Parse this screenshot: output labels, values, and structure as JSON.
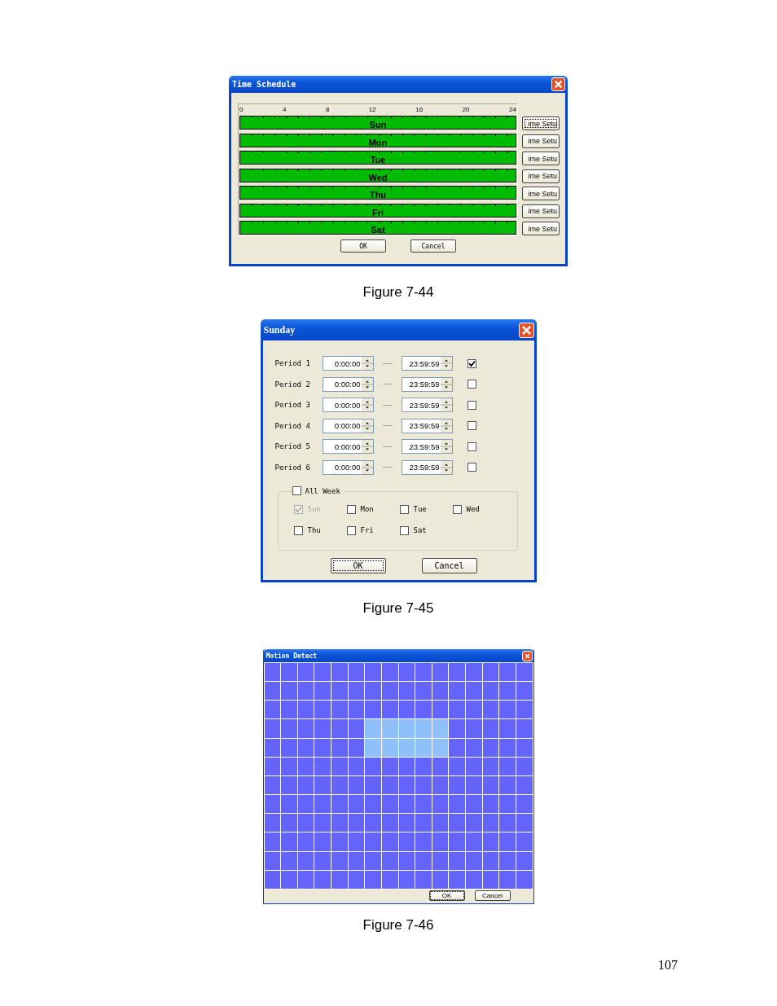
{
  "time_schedule": {
    "title": "Time Schedule",
    "hour_ticks": [
      "0",
      "4",
      "8",
      "12",
      "16",
      "20",
      "24"
    ],
    "days": [
      {
        "label": "Sun",
        "level": 1,
        "button": "ime Setu",
        "focused": true
      },
      {
        "label": "Mon",
        "level": 1,
        "button": "ime Setu",
        "focused": false
      },
      {
        "label": "Tue",
        "level": 1,
        "button": "ime Setu",
        "focused": false
      },
      {
        "label": "Wed",
        "level": 1,
        "button": "ime Setu",
        "focused": false
      },
      {
        "label": "Thu",
        "level": 1,
        "button": "ime Setu",
        "focused": false
      },
      {
        "label": "Fri",
        "level": 1,
        "button": "ime Setu",
        "focused": false
      },
      {
        "label": "Sat",
        "level": 1,
        "button": "ime Setu",
        "focused": false
      }
    ],
    "buttons": [
      {
        "label": "OK",
        "focused": false
      },
      {
        "label": "Cancel",
        "focused": false
      }
    ]
  },
  "caption_1": "Figure 7-44",
  "sunday": {
    "title": "Sunday",
    "periods": [
      {
        "label": "Period 1",
        "start": "0:00:00",
        "end": "23:59:59",
        "checked": true
      },
      {
        "label": "Period 2",
        "start": "0:00:00",
        "end": "23:59:59",
        "checked": false
      },
      {
        "label": "Period 3",
        "start": "0:00:00",
        "end": "23:59:59",
        "checked": false
      },
      {
        "label": "Period 4",
        "start": "0:00:00",
        "end": "23:59:59",
        "checked": false
      },
      {
        "label": "Period 5",
        "start": "0:00:00",
        "end": "23:59:59",
        "checked": false
      },
      {
        "label": "Period 6",
        "start": "0:00:00",
        "end": "23:59:59",
        "checked": false
      }
    ],
    "all_week": {
      "label": "All Week",
      "checked": false
    },
    "days": [
      {
        "label": "Sun",
        "checked": true,
        "disabled": true
      },
      {
        "label": "Mon",
        "checked": false,
        "disabled": false
      },
      {
        "label": "Tue",
        "checked": false,
        "disabled": false
      },
      {
        "label": "Wed",
        "checked": false,
        "disabled": false
      },
      {
        "label": "Thu",
        "checked": false,
        "disabled": false
      },
      {
        "label": "Fri",
        "checked": false,
        "disabled": false
      },
      {
        "label": "Sat",
        "checked": false,
        "disabled": false
      }
    ],
    "buttons": [
      {
        "label": "OK",
        "focused": true
      },
      {
        "label": "Cancel",
        "focused": false
      }
    ]
  },
  "caption_2": "Figure 7-45",
  "motion_detect": {
    "title": "Motion Detect",
    "grid": [
      {
        "cells": [
          false,
          false,
          false,
          false,
          false,
          false,
          false,
          false,
          false,
          false,
          false,
          false,
          false,
          false,
          false,
          false
        ]
      },
      {
        "cells": [
          false,
          false,
          false,
          false,
          false,
          false,
          false,
          false,
          false,
          false,
          false,
          false,
          false,
          false,
          false,
          false
        ]
      },
      {
        "cells": [
          false,
          false,
          false,
          false,
          false,
          false,
          false,
          false,
          false,
          false,
          false,
          false,
          false,
          false,
          false,
          false
        ]
      },
      {
        "cells": [
          false,
          false,
          false,
          false,
          false,
          false,
          true,
          true,
          true,
          true,
          true,
          false,
          false,
          false,
          false,
          false
        ]
      },
      {
        "cells": [
          false,
          false,
          false,
          false,
          false,
          false,
          true,
          true,
          true,
          true,
          true,
          false,
          false,
          false,
          false,
          false
        ]
      },
      {
        "cells": [
          false,
          false,
          false,
          false,
          false,
          false,
          false,
          false,
          false,
          false,
          false,
          false,
          false,
          false,
          false,
          false
        ]
      },
      {
        "cells": [
          false,
          false,
          false,
          false,
          false,
          false,
          false,
          false,
          false,
          false,
          false,
          false,
          false,
          false,
          false,
          false
        ]
      },
      {
        "cells": [
          false,
          false,
          false,
          false,
          false,
          false,
          false,
          false,
          false,
          false,
          false,
          false,
          false,
          false,
          false,
          false
        ]
      },
      {
        "cells": [
          false,
          false,
          false,
          false,
          false,
          false,
          false,
          false,
          false,
          false,
          false,
          false,
          false,
          false,
          false,
          false
        ]
      },
      {
        "cells": [
          false,
          false,
          false,
          false,
          false,
          false,
          false,
          false,
          false,
          false,
          false,
          false,
          false,
          false,
          false,
          false
        ]
      },
      {
        "cells": [
          false,
          false,
          false,
          false,
          false,
          false,
          false,
          false,
          false,
          false,
          false,
          false,
          false,
          false,
          false,
          false
        ]
      },
      {
        "cells": [
          false,
          false,
          false,
          false,
          false,
          false,
          false,
          false,
          false,
          false,
          false,
          false,
          false,
          false,
          false,
          false
        ]
      }
    ],
    "buttons": [
      {
        "label": "OK",
        "focused": true
      },
      {
        "label": "Cancel",
        "focused": false
      }
    ]
  },
  "caption_3": "Figure 7-46",
  "page_number": "107"
}
